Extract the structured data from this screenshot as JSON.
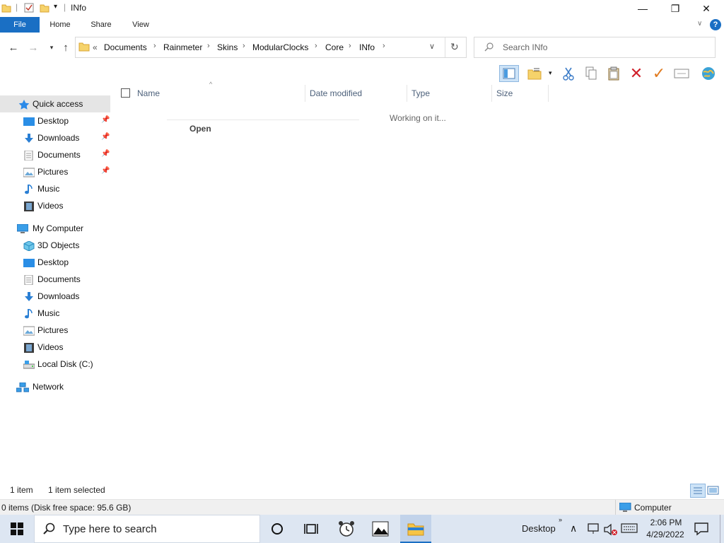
{
  "window": {
    "title": "INfo",
    "controls": {
      "minimize": "—",
      "maximize": "❐",
      "close": "✕"
    }
  },
  "ribbon": {
    "tabs": [
      "File",
      "Home",
      "Share",
      "View"
    ]
  },
  "address": {
    "overflow": "«",
    "crumbs": [
      "Documents",
      "Rainmeter",
      "Skins",
      "ModularClocks",
      "Core",
      "INfo"
    ]
  },
  "search": {
    "placeholder": "Search INfo"
  },
  "sidebar": {
    "quick_access": "Quick access",
    "quick_items": [
      "Desktop",
      "Downloads",
      "Documents",
      "Pictures",
      "Music",
      "Videos"
    ],
    "computer": "My Computer",
    "computer_items": [
      "3D Objects",
      "Desktop",
      "Documents",
      "Downloads",
      "Music",
      "Pictures",
      "Videos",
      "Local Disk (C:)"
    ],
    "network": "Network"
  },
  "columns": {
    "name": "Name",
    "date": "Date modified",
    "type": "Type",
    "size": "Size"
  },
  "content": {
    "working": "Working on it...",
    "open_item": "Open"
  },
  "status": {
    "items": "1 item",
    "selected": "1 item selected"
  },
  "details": {
    "free_space": "0 items (Disk free space: 95.6 GB)",
    "location": "Computer"
  },
  "taskbar": {
    "search_placeholder": "Type here to search",
    "desktop_label": "Desktop",
    "time": "2:06 PM",
    "date": "4/29/2022"
  },
  "colors": {
    "accent": "#1a6fc4",
    "taskbar": "#dde6f2",
    "selection": "#e5e5e5"
  }
}
